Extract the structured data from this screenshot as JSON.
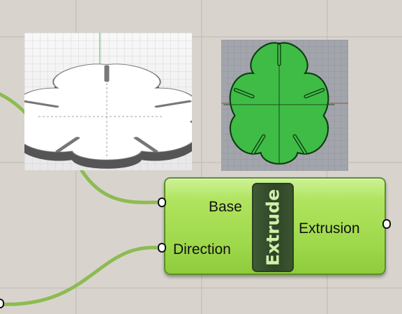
{
  "canvas": {
    "background": "#d8d4cd",
    "grid_color": "#c6c2bb",
    "wire_color": "#8dbb52"
  },
  "previews": {
    "perspective": {
      "label": "perspective-preview",
      "shape_color": "#ffffff",
      "background": "#f2f2f2"
    },
    "top": {
      "label": "top-preview",
      "shape_color": "#3fbc46",
      "background": "#a2a5ab"
    }
  },
  "component": {
    "title": "Extrude",
    "inputs": [
      {
        "label": "Base"
      },
      {
        "label": "Direction"
      }
    ],
    "outputs": [
      {
        "label": "Extrusion"
      }
    ],
    "body_color": "#a6dd52",
    "title_color": "#2f4628"
  }
}
